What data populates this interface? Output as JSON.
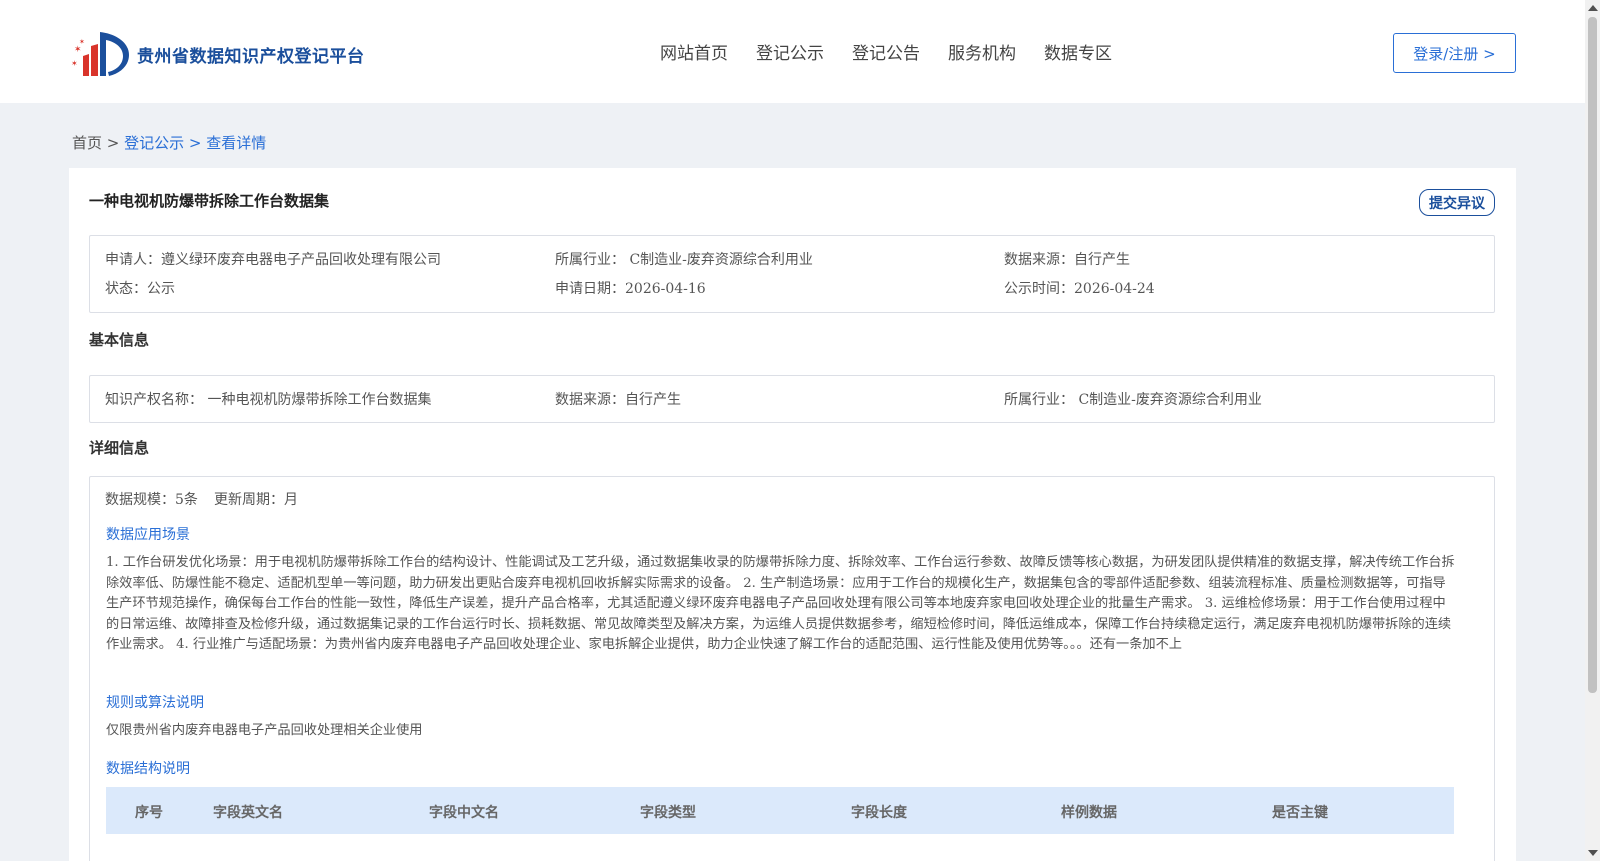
{
  "header": {
    "brand": "贵州省数据知识产权登记平台",
    "nav": [
      "网站首页",
      "登记公示",
      "登记公告",
      "服务机构",
      "数据专区"
    ],
    "login_label": "登录/注册 >"
  },
  "breadcrumb": {
    "home": "首页 >",
    "section": "登记公示 >",
    "current": "查看详情"
  },
  "detail": {
    "title": "一种电视机防爆带拆除工作台数据集",
    "objection_label": "提交异议",
    "summary": {
      "applicant": "申请人：遵义绿环废弃电器电子产品回收处理有限公司",
      "industry": "所属行业： C制造业-废弃资源综合利用业",
      "source": "数据来源：自行产生",
      "status": "状态：公示",
      "apply_date": "申请日期：2026-04-16",
      "publish_date": "公示时间：2026-04-24"
    },
    "basic_title": "基本信息",
    "basic": {
      "ip_name": "知识产权名称： 一种电视机防爆带拆除工作台数据集",
      "source": "数据来源：自行产生",
      "industry": "所属行业： C制造业-废弃资源综合利用业"
    },
    "detail_title": "详细信息",
    "scale": "数据规模：5条",
    "cycle": "更新周期：月",
    "scenario_title": "数据应用场景",
    "scenario_text": "1. 工作台研发优化场景：用于电视机防爆带拆除工作台的结构设计、性能调试及工艺升级，通过数据集收录的防爆带拆除力度、拆除效率、工作台运行参数、故障反馈等核心数据，为研发团队提供精准的数据支撑，解决传统工作台拆除效率低、防爆性能不稳定、适配机型单一等问题，助力研发出更贴合废弃电视机回收拆解实际需求的设备。 2. 生产制造场景：应用于工作台的规模化生产，数据集包含的零部件适配参数、组装流程标准、质量检测数据等，可指导生产环节规范操作，确保每台工作台的性能一致性，降低生产误差，提升产品合格率，尤其适配遵义绿环废弃电器电子产品回收处理有限公司等本地废弃家电回收处理企业的批量生产需求。 3. 运维检修场景：用于工作台使用过程中的日常运维、故障排查及检修升级，通过数据集记录的工作台运行时长、损耗数据、常见故障类型及解决方案，为运维人员提供数据参考，缩短检修时间，降低运维成本，保障工作台持续稳定运行，满足废弃电视机防爆带拆除的连续作业需求。 4. 行业推广与适配场景：为贵州省内废弃电器电子产品回收处理企业、家电拆解企业提供，助力企业快速了解工作台的适配范围、运行性能及使用优势等。。。还有一条加不上",
    "rule_title": "规则或算法说明",
    "rule_text": "仅限贵州省内废弃电器电子产品回收处理相关企业使用",
    "structure_title": "数据结构说明",
    "table_headers": [
      "序号",
      "字段英文名",
      "字段中文名",
      "字段类型",
      "字段长度",
      "样例数据",
      "是否主键"
    ]
  },
  "colors": {
    "brand": "#1b4f9c",
    "link": "#2a6fd6",
    "table_header_bg": "#dbe9fb",
    "page_bg": "#eef1f5"
  }
}
